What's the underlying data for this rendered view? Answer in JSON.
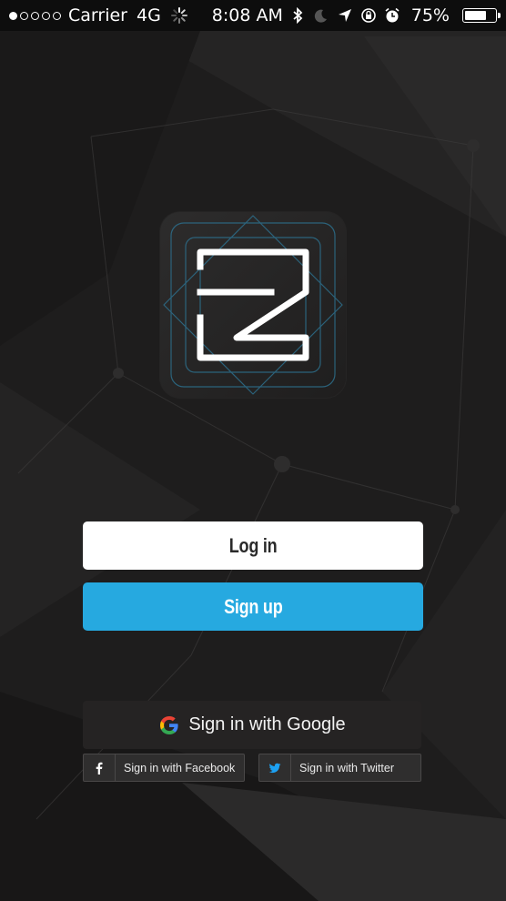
{
  "status_bar": {
    "carrier": "Carrier",
    "network": "4G",
    "time": "8:08 AM",
    "battery_percent": "75%",
    "battery_level": 0.75,
    "signal_strength": 1,
    "signal_max": 5,
    "icons": [
      "bluetooth-icon",
      "moon-icon",
      "location-arrow-icon",
      "rotation-lock-icon",
      "alarm-icon"
    ]
  },
  "logo": {
    "icon": "z-logo-icon"
  },
  "buttons": {
    "login_label": "Log in",
    "signup_label": "Sign up",
    "google_label": "Sign in with Google",
    "facebook_label": "Sign in with Facebook",
    "twitter_label": "Sign in with Twitter"
  },
  "colors": {
    "background": "#1e1d1d",
    "signup": "#26a9e0",
    "login": "#ffffff",
    "twitter": "#1da1f2"
  }
}
